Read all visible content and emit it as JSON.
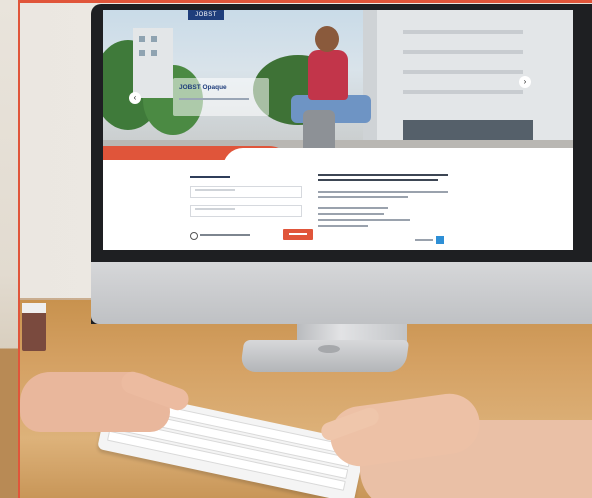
{
  "photo": {
    "subject": "person using desktop computer displaying JOBST website",
    "screen": {
      "logo_text": "JOBST",
      "hero_title": "JOBST Opaque",
      "arrow_left": "‹",
      "arrow_right": "›"
    }
  },
  "colors": {
    "frame_accent": "#e0553a",
    "brand_blue": "#1f3e7c",
    "button_accent": "#e0553a"
  }
}
